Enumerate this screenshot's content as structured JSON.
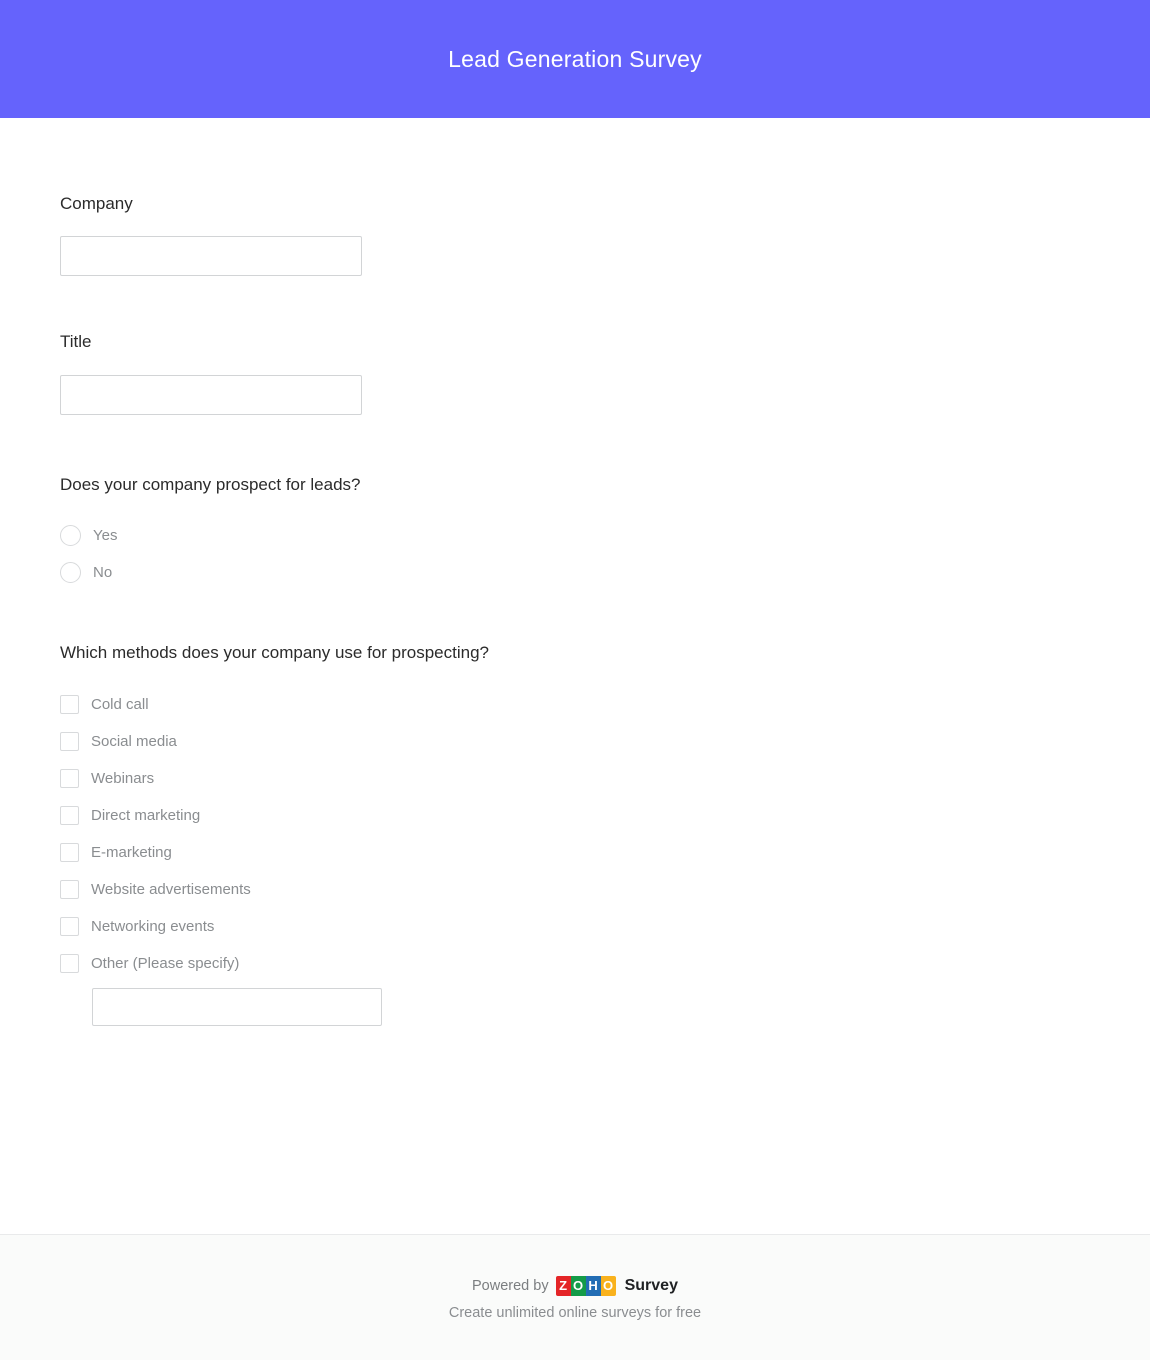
{
  "header": {
    "title": "Lead Generation Survey",
    "background_color": "#6563FC",
    "title_color": "#FFFFFF"
  },
  "form": {
    "questions": [
      {
        "id": "company",
        "type": "text",
        "label": "Company",
        "value": "",
        "placeholder": ""
      },
      {
        "id": "title",
        "type": "text",
        "label": "Title",
        "value": "",
        "placeholder": ""
      },
      {
        "id": "prospect_for_leads",
        "type": "radio",
        "label": "Does your company prospect for leads?",
        "options": [
          {
            "label": "Yes",
            "selected": false
          },
          {
            "label": "No",
            "selected": false
          }
        ]
      },
      {
        "id": "prospecting_methods",
        "type": "checkbox",
        "label": "Which methods does your company use for prospecting?",
        "options": [
          {
            "label": "Cold call",
            "checked": false
          },
          {
            "label": "Social media",
            "checked": false
          },
          {
            "label": "Webinars",
            "checked": false
          },
          {
            "label": "Direct marketing",
            "checked": false
          },
          {
            "label": "E-marketing",
            "checked": false
          },
          {
            "label": "Website advertisements",
            "checked": false
          },
          {
            "label": "Networking events",
            "checked": false
          },
          {
            "label": "Other (Please specify)",
            "checked": false
          }
        ],
        "other_input": {
          "value": "",
          "placeholder": ""
        }
      }
    ]
  },
  "footer": {
    "powered_by_text": "Powered by",
    "brand_tiles": [
      {
        "letter": "Z",
        "color": "#E42527"
      },
      {
        "letter": "O",
        "color": "#149B48"
      },
      {
        "letter": "H",
        "color": "#226DB4"
      },
      {
        "letter": "O",
        "color": "#F9B21D"
      }
    ],
    "product_name": "Survey",
    "tagline": "Create unlimited online surveys for free"
  }
}
